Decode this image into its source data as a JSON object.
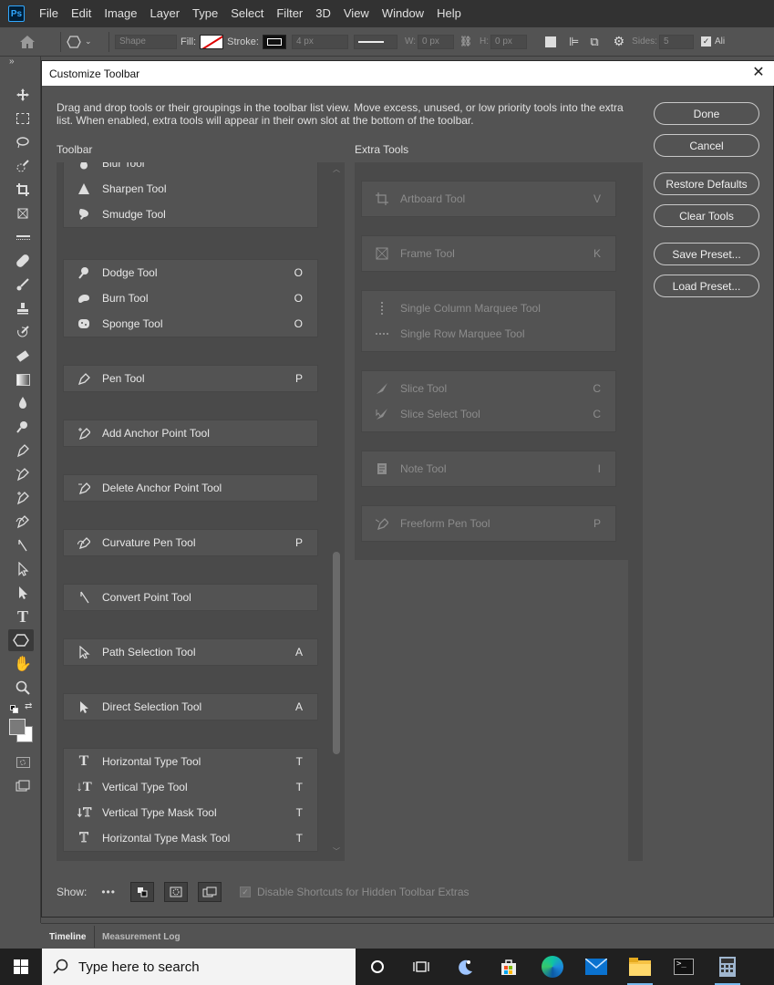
{
  "app": {
    "logo": "Ps",
    "menu": [
      "File",
      "Edit",
      "Image",
      "Layer",
      "Type",
      "Select",
      "Filter",
      "3D",
      "View",
      "Window",
      "Help"
    ]
  },
  "options_bar": {
    "mode": "Shape",
    "fill_label": "Fill:",
    "stroke_label": "Stroke:",
    "stroke_width": "4 px",
    "w_label": "W:",
    "w_value": "0 px",
    "h_label": "H:",
    "h_value": "0 px",
    "sides_label": "Sides:",
    "sides_value": "5",
    "trailing": "Ali"
  },
  "dialog": {
    "title": "Customize Toolbar",
    "description": "Drag and drop tools or their groupings in the toolbar list view. Move excess, unused, or low priority tools into the extra list. When enabled, extra tools will appear in their own slot at the bottom of the toolbar.",
    "toolbar_header": "Toolbar",
    "extra_header": "Extra Tools",
    "toolbar_groups": [
      {
        "tools": [
          {
            "name": "Blur Tool",
            "icon": "blur-icon",
            "key": ""
          },
          {
            "name": "Sharpen Tool",
            "icon": "sharpen-icon",
            "key": ""
          },
          {
            "name": "Smudge Tool",
            "icon": "smudge-icon",
            "key": ""
          }
        ]
      },
      {
        "tools": [
          {
            "name": "Dodge Tool",
            "icon": "dodge-icon",
            "key": "O"
          },
          {
            "name": "Burn Tool",
            "icon": "burn-icon",
            "key": "O"
          },
          {
            "name": "Sponge Tool",
            "icon": "sponge-icon",
            "key": "O"
          }
        ]
      },
      {
        "tools": [
          {
            "name": "Pen Tool",
            "icon": "pen-icon",
            "key": "P"
          }
        ]
      },
      {
        "tools": [
          {
            "name": "Add Anchor Point Tool",
            "icon": "add-anchor-icon",
            "key": ""
          }
        ]
      },
      {
        "tools": [
          {
            "name": "Delete Anchor Point Tool",
            "icon": "delete-anchor-icon",
            "key": ""
          }
        ]
      },
      {
        "tools": [
          {
            "name": "Curvature Pen Tool",
            "icon": "curvature-pen-icon",
            "key": "P"
          }
        ]
      },
      {
        "tools": [
          {
            "name": "Convert Point Tool",
            "icon": "convert-point-icon",
            "key": ""
          }
        ]
      },
      {
        "tools": [
          {
            "name": "Path Selection Tool",
            "icon": "path-selection-icon",
            "key": "A"
          }
        ]
      },
      {
        "tools": [
          {
            "name": "Direct Selection Tool",
            "icon": "direct-selection-icon",
            "key": "A"
          }
        ]
      },
      {
        "tools": [
          {
            "name": "Horizontal Type Tool",
            "icon": "horizontal-type-icon",
            "key": "T"
          },
          {
            "name": "Vertical Type Tool",
            "icon": "vertical-type-icon",
            "key": "T"
          },
          {
            "name": "Vertical Type Mask Tool",
            "icon": "vertical-type-mask-icon",
            "key": "T"
          },
          {
            "name": "Horizontal Type Mask Tool",
            "icon": "horizontal-type-mask-icon",
            "key": "T"
          }
        ]
      }
    ],
    "extra_groups": [
      {
        "tools": [
          {
            "name": "Artboard Tool",
            "icon": "artboard-icon",
            "key": "V"
          }
        ]
      },
      {
        "tools": [
          {
            "name": "Frame Tool",
            "icon": "frame-icon",
            "key": "K"
          }
        ]
      },
      {
        "tools": [
          {
            "name": "Single Column Marquee Tool",
            "icon": "single-column-marquee-icon",
            "key": ""
          },
          {
            "name": "Single Row Marquee Tool",
            "icon": "single-row-marquee-icon",
            "key": ""
          }
        ]
      },
      {
        "tools": [
          {
            "name": "Slice Tool",
            "icon": "slice-icon",
            "key": "C"
          },
          {
            "name": "Slice Select Tool",
            "icon": "slice-select-icon",
            "key": "C"
          }
        ]
      },
      {
        "tools": [
          {
            "name": "Note Tool",
            "icon": "note-icon",
            "key": "I"
          }
        ]
      },
      {
        "tools": [
          {
            "name": "Freeform Pen Tool",
            "icon": "freeform-pen-icon",
            "key": "P"
          }
        ]
      }
    ],
    "buttons": {
      "done": "Done",
      "cancel": "Cancel",
      "restore": "Restore Defaults",
      "clear": "Clear Tools",
      "save": "Save Preset...",
      "load": "Load Preset..."
    },
    "show_label": "Show:",
    "show_more": "•••",
    "disable_shortcuts": "Disable Shortcuts for Hidden Toolbar Extras"
  },
  "bottom_tabs": [
    "Timeline",
    "Measurement Log"
  ],
  "taskbar": {
    "search_placeholder": "Type here to search"
  }
}
